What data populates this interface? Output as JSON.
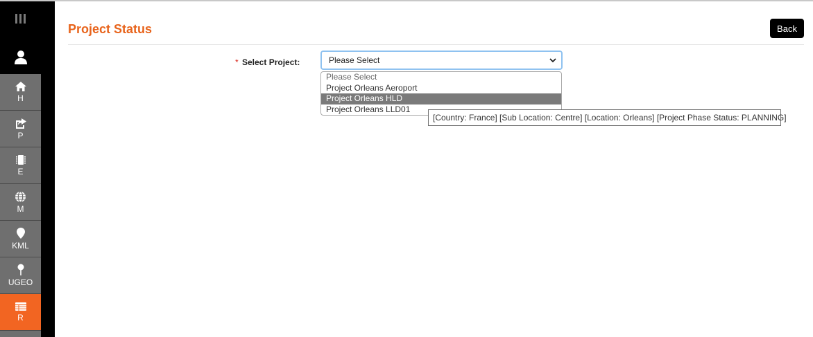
{
  "page": {
    "title": "Project Status",
    "back_label": "Back"
  },
  "sidebar": {
    "items": [
      {
        "label": "H",
        "icon": "home-icon"
      },
      {
        "label": "P",
        "icon": "share-icon"
      },
      {
        "label": "E",
        "icon": "chip-icon"
      },
      {
        "label": "M",
        "icon": "globe-icon"
      },
      {
        "label": "KML",
        "icon": "map-marker-icon"
      },
      {
        "label": "UGEO",
        "icon": "pin-icon"
      },
      {
        "label": "R",
        "icon": "table-icon"
      }
    ],
    "active": "R"
  },
  "form": {
    "required_mark": "*",
    "select_label": "Select Project:",
    "selected_value": "Please Select",
    "options": [
      "Please Select",
      "Project Orleans Aeroport",
      "Project Orleans HLD",
      "Project Orleans LLD01"
    ],
    "highlighted_option": "Project Orleans HLD"
  },
  "tooltip": {
    "text": "[Country: France] [Sub Location: Centre] [Location: Orleans] [Project Phase Status: PLANNING]"
  },
  "colors": {
    "accent": "#e8641c",
    "active_nav": "#f26522",
    "sidebar": "#000000",
    "nav_item": "#6f6f6f"
  }
}
